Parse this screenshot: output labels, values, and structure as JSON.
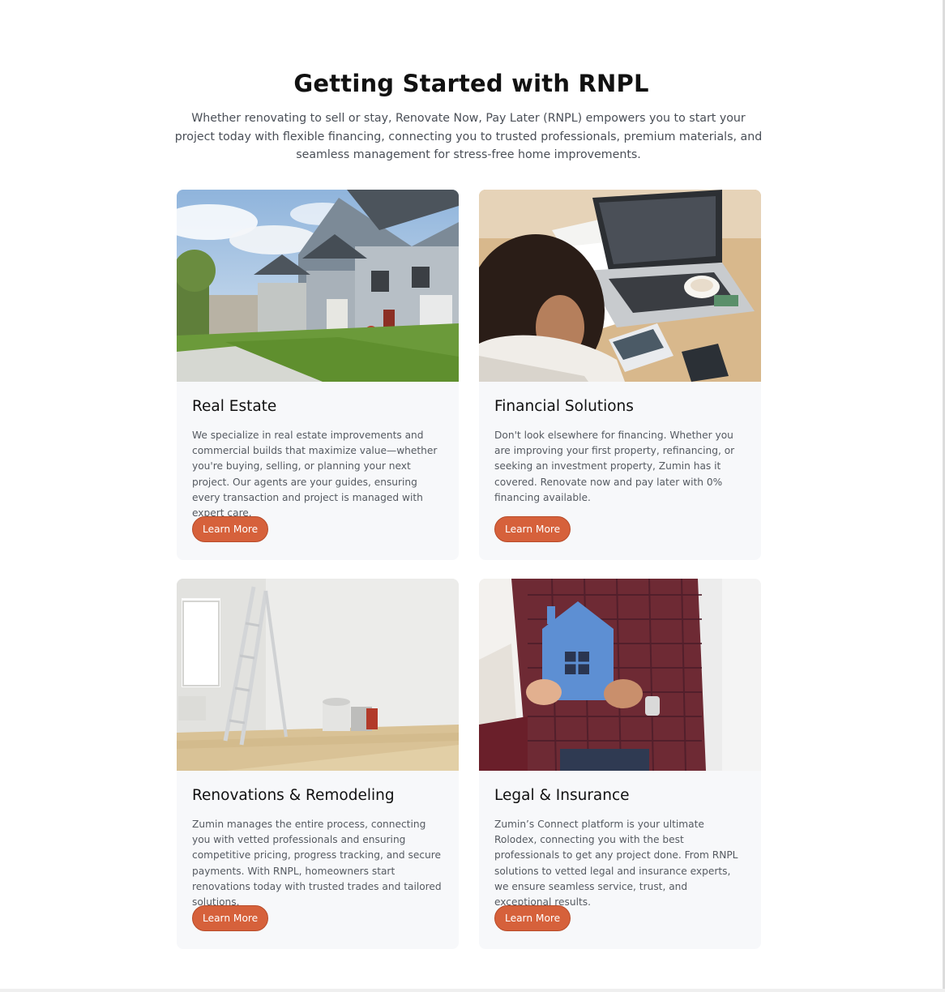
{
  "section": {
    "title": "Getting Started with RNPL",
    "intro": "Whether renovating to sell or stay, Renovate Now, Pay Later (RNPL) empowers you to start your project today with flexible financing, connecting you to trusted professionals, premium materials, and seamless management for stress-free home improvements."
  },
  "colors": {
    "accent": "#d6613b",
    "card_bg": "#f7f8fa"
  },
  "cards": [
    {
      "title": "Real Estate",
      "text": "We specialize in real estate improvements and commercial builds that maximize value—whether you're buying, selling, or planning your next project. Our agents are your guides, ensuring every transaction and project is managed with expert care.",
      "button": "Learn More",
      "image": "suburban-houses-photo"
    },
    {
      "title": "Financial Solutions",
      "text": "Don't look elsewhere for financing. Whether you are improving your first property, refinancing, or seeking an investment property, Zumin has it covered. Renovate now and pay later with 0% financing available.",
      "button": "Learn More",
      "image": "woman-calculating-finances-photo"
    },
    {
      "title": "Renovations & Remodeling",
      "text": "Zumin manages the entire process, connecting you with vetted professionals and ensuring competitive pricing, progress tracking, and secure payments. With RNPL, homeowners start renovations today with trusted trades and tailored solutions.",
      "button": "Learn More",
      "image": "empty-room-ladder-photo"
    },
    {
      "title": "Legal & Insurance",
      "text": "Zumin’s Connect platform is your ultimate Rolodex, connecting you with the best professionals to get any project done. From RNPL solutions to vetted legal and insurance experts, we ensure seamless service, trust, and exceptional results.",
      "button": "Learn More",
      "image": "couple-holding-paper-house-photo"
    }
  ]
}
